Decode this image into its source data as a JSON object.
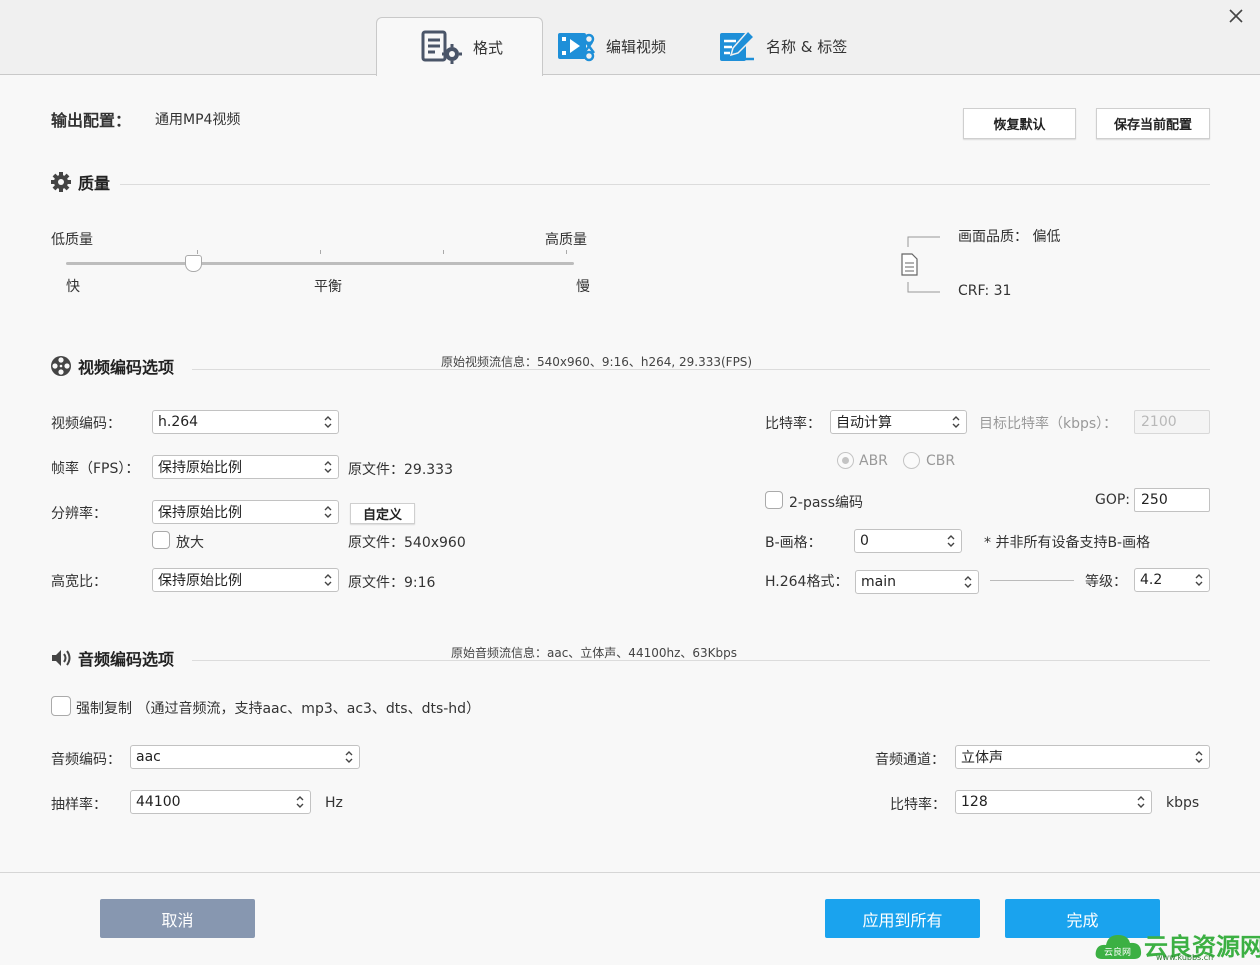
{
  "tabs": [
    {
      "label": "格式",
      "icon": "format-settings-icon",
      "active": true
    },
    {
      "label": "编辑视频",
      "icon": "edit-video-icon",
      "active": false
    },
    {
      "label": "名称 & 标签",
      "icon": "name-tag-icon",
      "active": false
    }
  ],
  "header": {
    "output_label": "输出配置：",
    "output_value": "通用MP4视频",
    "restore_default": "恢复默认",
    "save_config": "保存当前配置"
  },
  "quality": {
    "title": "质量",
    "low_label": "低质量",
    "high_label": "高质量",
    "fast_label": "快",
    "balance_label": "平衡",
    "slow_label": "慢",
    "slider_level": 0.25,
    "picture_quality": "画面品质： 偏低",
    "crf": "CRF: 31"
  },
  "video": {
    "title": "视频编码选项",
    "source_info": "原始视频流信息：540x960、9:16、h264, 29.333(FPS)",
    "codec_label": "视频编码：",
    "codec_value": "h.264",
    "fps_label": "帧率（FPS）：",
    "fps_value": "保持原始比例",
    "fps_original": "原文件：29.333",
    "resolution_label": "分辨率：",
    "resolution_value": "保持原始比例",
    "custom_button": "自定义",
    "upscale_label": "放大",
    "resolution_original": "原文件：540x960",
    "aspect_label": "高宽比：",
    "aspect_value": "保持原始比例",
    "aspect_original": "原文件：9:16",
    "bitrate_label": "比特率：",
    "bitrate_value": "自动计算",
    "target_bitrate_label": "目标比特率（kbps）：",
    "target_bitrate_value": "2100",
    "abr_label": "ABR",
    "cbr_label": "CBR",
    "two_pass_label": "2-pass编码",
    "gop_label": "GOP:",
    "gop_value": "250",
    "bframe_label": "B-画格：",
    "bframe_value": "0",
    "bframe_note": "* 并非所有设备支持B-画格",
    "h264_profile_label": "H.264格式：",
    "h264_profile_value": "main",
    "level_label": "等级：",
    "level_value": "4.2"
  },
  "audio": {
    "title": "音频编码选项",
    "source_info": "原始音频流信息：aac、立体声、44100hz、63Kbps",
    "force_copy_label": "强制复制 （通过音频流，支持aac、mp3、ac3、dts、dts-hd）",
    "codec_label": "音频编码：",
    "codec_value": "aac",
    "sample_rate_label": "抽样率：",
    "sample_rate_value": "44100",
    "sample_rate_unit": "Hz",
    "channel_label": "音频通道：",
    "channel_value": "立体声",
    "bitrate_label": "比特率：",
    "bitrate_value": "128",
    "bitrate_unit": "kbps"
  },
  "footer": {
    "cancel": "取消",
    "apply_all": "应用到所有",
    "done": "完成"
  },
  "watermark": {
    "text": "云良资源网",
    "small": "云良网",
    "url": "www.kubbs.cn"
  },
  "colors": {
    "accent_blue": "#1aa3ee",
    "cancel_gray": "#8797b0",
    "icon_blue": "#1e8fd8"
  }
}
